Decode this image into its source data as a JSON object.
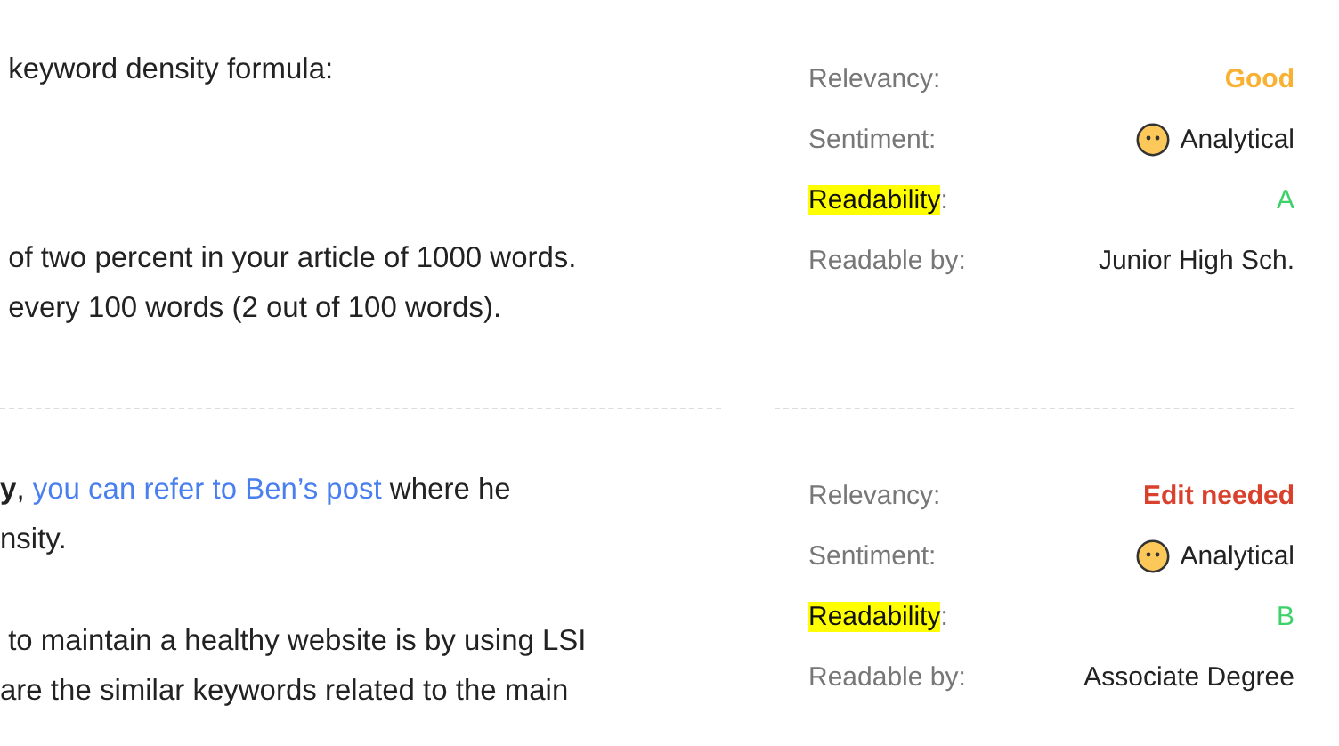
{
  "sections": [
    {
      "paragraphs": [
        {
          "lines": [
            [
              {
                "kind": "text",
                "text": " keyword density formula:"
              }
            ]
          ]
        },
        {
          "lines": [
            [
              {
                "kind": "text",
                "text": " of two percent in your article of 1000 words."
              }
            ],
            [
              {
                "kind": "text",
                "text": " every 100 words (2 out of 100 words)."
              }
            ]
          ]
        }
      ],
      "stats": [
        {
          "label": "Relevancy",
          "punct": ":",
          "highlighted": false,
          "kind": "plain",
          "value": "Good",
          "color": "#f8b133"
        },
        {
          "label": "Sentiment",
          "punct": ":",
          "highlighted": false,
          "kind": "sentiment",
          "value": "Analytical",
          "color": "#222222"
        },
        {
          "label": "Readability",
          "punct": ":",
          "highlighted": true,
          "kind": "plain",
          "value": "A",
          "color": "#3dd16a"
        },
        {
          "label": "Readable by",
          "punct": ":",
          "highlighted": false,
          "kind": "plain",
          "value": "Junior High Sch.",
          "color": "#222222"
        }
      ]
    },
    {
      "paragraphs": [
        {
          "lines": [
            [
              {
                "kind": "text",
                "text": "**y**, "
              },
              {
                "kind": "link",
                "text": "you can refer to Ben’s post"
              },
              {
                "kind": "text",
                "text": " where he"
              }
            ],
            [
              {
                "kind": "text",
                "text": "nsity."
              }
            ]
          ]
        },
        {
          "lines": [
            [
              {
                "kind": "text",
                "text": " to maintain a healthy website is by using LSI"
              }
            ],
            [
              {
                "kind": "text",
                "text": "are the similar keywords related to the main"
              }
            ]
          ]
        }
      ],
      "stats": [
        {
          "label": "Relevancy",
          "punct": ":",
          "highlighted": false,
          "kind": "plain",
          "value": "Edit needed",
          "color": "#d9412c"
        },
        {
          "label": "Sentiment",
          "punct": ":",
          "highlighted": false,
          "kind": "sentiment",
          "value": "Analytical",
          "color": "#222222"
        },
        {
          "label": "Readability",
          "punct": ":",
          "highlighted": true,
          "kind": "plain",
          "value": "B",
          "color": "#3dd16a"
        },
        {
          "label": "Readable by",
          "punct": ":",
          "highlighted": false,
          "kind": "plain",
          "value": "Associate Degree",
          "color": "#222222"
        }
      ]
    }
  ]
}
